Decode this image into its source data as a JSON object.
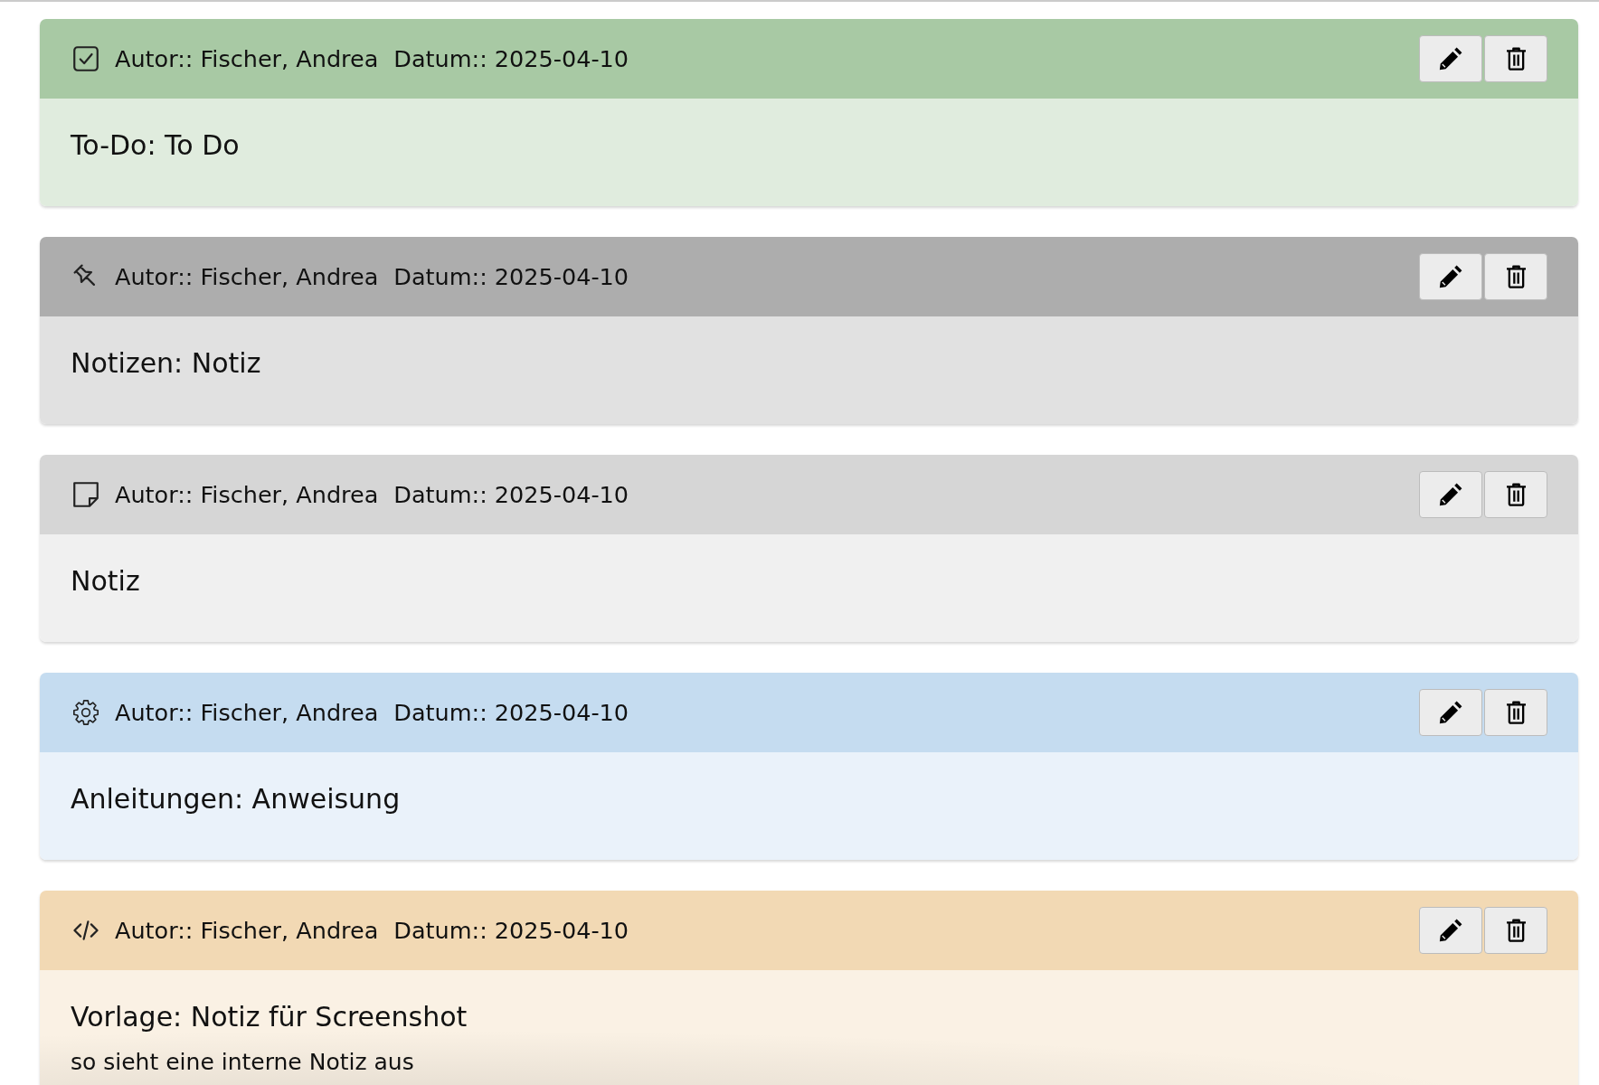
{
  "notes": [
    {
      "kind": "todo",
      "color": "#a8c9a4",
      "author": "Autor:: Fischer, Andrea",
      "date": "Datum:: 2025-04-10",
      "title": "To-Do: To Do"
    },
    {
      "kind": "pinned",
      "color": "#adadad",
      "author": "Autor:: Fischer, Andrea",
      "date": "Datum:: 2025-04-10",
      "title": "Notizen: Notiz"
    },
    {
      "kind": "note",
      "color": "#d6d6d6",
      "author": "Autor:: Fischer, Andrea",
      "date": "Datum:: 2025-04-10",
      "title": "Notiz"
    },
    {
      "kind": "instruction",
      "color": "#c5dcf0",
      "author": "Autor:: Fischer, Andrea",
      "date": "Datum:: 2025-04-10",
      "title": "Anleitungen: Anweisung"
    },
    {
      "kind": "template",
      "color": "#f2d9b4",
      "author": "Autor:: Fischer, Andrea",
      "date": "Datum:: 2025-04-10",
      "title": "Vorlage: Notiz für Screenshot",
      "text": "so sieht eine interne Notiz aus"
    }
  ]
}
